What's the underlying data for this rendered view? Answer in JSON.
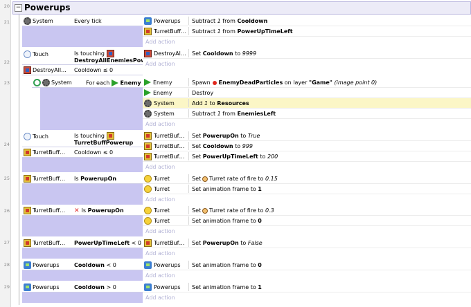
{
  "group": {
    "toggle": "−",
    "title": "Powerups"
  },
  "line_numbers": [
    "20",
    "21",
    "22",
    "23",
    "24",
    "25",
    "26",
    "27",
    "28",
    "29"
  ],
  "add_action": "Add action",
  "e21": {
    "c1_obj": "System",
    "c1_text": "Every tick",
    "a1_obj": "Powerups",
    "a1_pre": "Subtract ",
    "a1_val": "1",
    "a1_mid": " from ",
    "a1_name": "Cooldown",
    "a2_obj": "TurretBuff…",
    "a2_pre": "Subtract ",
    "a2_val": "1",
    "a2_mid": " from ",
    "a2_name": "PowerUpTimeLeft"
  },
  "e22": {
    "c1_obj": "Touch",
    "c1_text_a": "Is touching",
    "c1_text_b": "DestroyAllEnemiesPower",
    "c2_obj": "DestroyAll…",
    "c2_text": "Cooldown ≤ 0",
    "a1_obj": "DestroyAl…",
    "a1_pre": "Set ",
    "a1_name": "Cooldown",
    "a1_mid": " to ",
    "a1_val": "9999"
  },
  "e23": {
    "c1_obj": "System",
    "c1_text_a": "For each",
    "c1_text_b": "Enemy",
    "a1_obj": "Enemy",
    "a1_pre": "Spawn",
    "a1_name": "EnemyDeadParticles",
    "a1_mid": " on layer ",
    "a1_layer": "\"Game\"",
    "a1_post": " (image point 0)",
    "a2_obj": "Enemy",
    "a2_text": "Destroy",
    "a3_obj": "System",
    "a3_pre": "Add ",
    "a3_val": "1",
    "a3_mid": " to ",
    "a3_name": "Resources",
    "a4_obj": "System",
    "a4_pre": "Subtract ",
    "a4_val": "1",
    "a4_mid": " from ",
    "a4_name": "EnemiesLeft"
  },
  "e24": {
    "c1_obj": "Touch",
    "c1_text_a": "Is touching",
    "c1_text_b": "TurretBuffPowerup",
    "c2_obj": "TurretBuff…",
    "c2_text": "Cooldown ≤ 0",
    "a1_obj": "TurretBuf…",
    "a1_pre": "Set ",
    "a1_name": "PowerupOn",
    "a1_mid": " to ",
    "a1_val": "True",
    "a2_obj": "TurretBuf…",
    "a2_pre": "Set ",
    "a2_name": "Cooldown",
    "a2_mid": " to ",
    "a2_val": "999",
    "a3_obj": "TurretBuf…",
    "a3_pre": "Set ",
    "a3_name": "PowerUpTimeLeft",
    "a3_mid": " to ",
    "a3_val": "200"
  },
  "e25": {
    "c1_obj": "TurretBuff…",
    "c1_pre": "Is ",
    "c1_name": "PowerupOn",
    "a1_obj": "Turret",
    "a1_pre": "Set",
    "a1_mid": "Turret rate of fire to ",
    "a1_val": "0.15",
    "a2_obj": "Turret",
    "a2_pre": "Set animation frame to ",
    "a2_val": "1"
  },
  "e26": {
    "c1_obj": "TurretBuff…",
    "c1_pre": "Is ",
    "c1_name": "PowerupOn",
    "a1_obj": "Turret",
    "a1_pre": "Set",
    "a1_mid": "Turret rate of fire to ",
    "a1_val": "0.3",
    "a2_obj": "Turret",
    "a2_pre": "Set animation frame to ",
    "a2_val": "0"
  },
  "e27": {
    "c1_obj": "TurretBuff…",
    "c1_name": "PowerUpTimeLeft",
    "c1_post": " < 0",
    "a1_obj": "TurretBuf…",
    "a1_pre": "Set ",
    "a1_name": "PowerupOn",
    "a1_mid": " to ",
    "a1_val": "False"
  },
  "e28": {
    "c1_obj": "Powerups",
    "c1_name": "Cooldown",
    "c1_post": " < 0",
    "a1_obj": "Powerups",
    "a1_pre": "Set animation frame to ",
    "a1_val": "0"
  },
  "e29": {
    "c1_obj": "Powerups",
    "c1_name": "Cooldown",
    "c1_post": " > 0",
    "a1_obj": "Powerups",
    "a1_pre": "Set animation frame to ",
    "a1_val": "1"
  }
}
